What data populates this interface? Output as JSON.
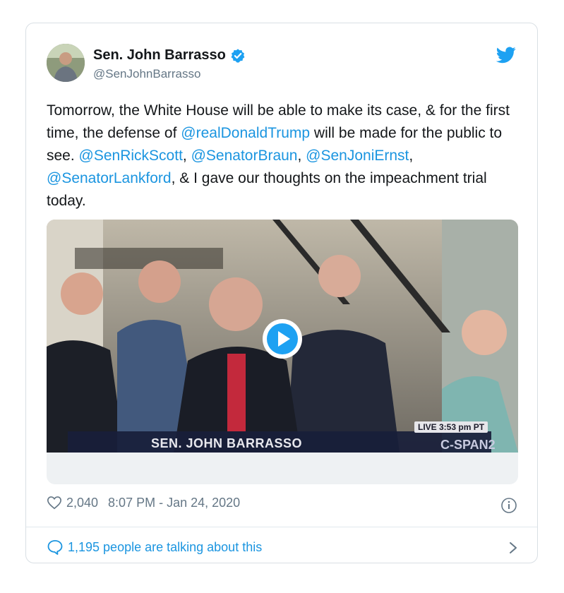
{
  "author": {
    "name": "Sen. John Barrasso",
    "handle": "@SenJohnBarrasso",
    "verified": true
  },
  "tweet": {
    "segments": [
      {
        "text": "Tomorrow, the White House will be able to make its case, & for the first time, the defense of ",
        "mention": false
      },
      {
        "text": "@realDonaldTrump",
        "mention": true
      },
      {
        "text": " will be made for the public to see.  ",
        "mention": false
      },
      {
        "text": "@SenRickScott",
        "mention": true
      },
      {
        "text": ", ",
        "mention": false
      },
      {
        "text": "@SenatorBraun",
        "mention": true
      },
      {
        "text": ", ",
        "mention": false
      },
      {
        "text": "@SenJoniErnst",
        "mention": true
      },
      {
        "text": ", ",
        "mention": false
      },
      {
        "text": "@SenatorLankford",
        "mention": true
      },
      {
        "text": ", & I gave our thoughts on the impeachment trial today.",
        "mention": false
      }
    ]
  },
  "video": {
    "lower_third": "SEN. JOHN BARRASSO",
    "live_badge": "LIVE  3:53 pm PT",
    "network": "C-SPAN2"
  },
  "stats": {
    "likes": "2,040",
    "timestamp": "8:07 PM - Jan 24, 2020"
  },
  "footer": {
    "talking": "1,195 people are talking about this"
  },
  "icons": {
    "verified": "verified-badge-icon",
    "bird": "twitter-bird-icon",
    "play": "play-icon",
    "heart": "heart-icon",
    "info": "info-icon",
    "bubble": "speech-bubble-icon",
    "chevron": "chevron-right-icon"
  },
  "colors": {
    "link": "#1b95e0",
    "secondary": "#657786",
    "text": "#14171a"
  }
}
